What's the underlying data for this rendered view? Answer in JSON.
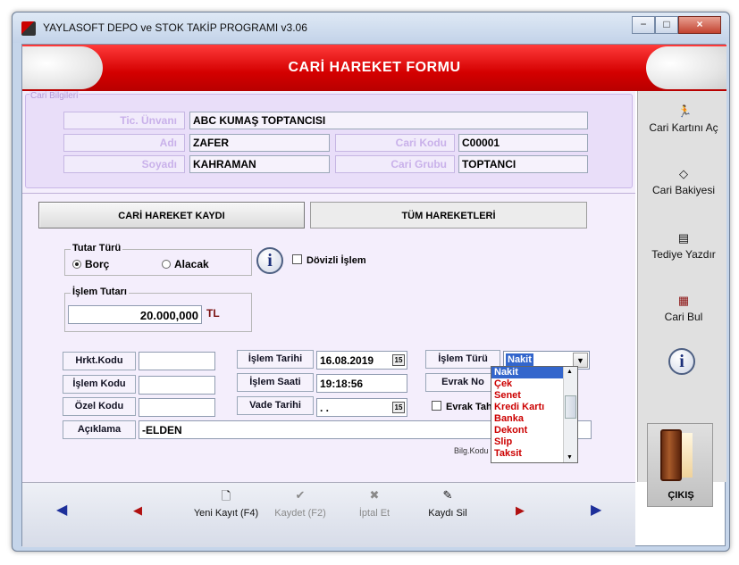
{
  "window": {
    "title": "YAYLASOFT DEPO ve STOK TAKİP PROGRAMI v3.06",
    "minimize": "−",
    "maximize": "□",
    "close": "×"
  },
  "header": {
    "title": "CARİ HAREKET FORMU"
  },
  "cari": {
    "group_title": "Cari Bilgileri",
    "unvan_label": "Tic. Ünvanı",
    "unvan": "ABC KUMAŞ TOPTANCISI",
    "adi_label": "Adı",
    "adi": "ZAFER",
    "soyadi_label": "Soyadı",
    "soyadi": "KAHRAMAN",
    "kod_label": "Cari Kodu",
    "kod": "C00001",
    "grup_label": "Cari Grubu",
    "grup": "TOPTANCI"
  },
  "tabs": [
    "CARİ HAREKET KAYDI",
    "TÜM HAREKETLERİ"
  ],
  "tutar": {
    "title": "Tutar Türü",
    "borc": "Borç",
    "alacak": "Alacak",
    "selected": "Borç",
    "doviz_label": "Dövizli İşlem"
  },
  "islem_tutari": {
    "title": "İşlem Tutarı",
    "value": "20.000,000",
    "currency": "TL"
  },
  "fields": {
    "hrkt_kodu": "Hrkt.Kodu",
    "islem_kodu": "İşlem Kodu",
    "ozel_kodu": "Özel Kodu",
    "aciklama_label": "Açıklama",
    "aciklama": "-ELDEN",
    "islem_tarihi_label": "İşlem Tarihi",
    "islem_tarihi": "16.08.2019",
    "islem_saati_label": "İşlem Saati",
    "islem_saati": "19:18:56",
    "vade_tarihi_label": "Vade Tarihi",
    "vade_tarihi": " . .",
    "islem_turu_label": "İşlem Türü",
    "islem_turu": "Nakit",
    "evrak_no_label": "Evrak No",
    "evrak_tah_label": "Evrak Tah",
    "bilg_kodu_label": "Bilg.Kodu",
    "bilg_kodu_colon": ":",
    "cal_label": "15"
  },
  "dropdown": {
    "options": [
      "Nakit",
      "Çek",
      "Senet",
      "Kredi Kartı",
      "Banka",
      "Dekont",
      "Slip",
      "Taksit"
    ],
    "selected": "Nakit"
  },
  "right_panel": {
    "cari_karti": "Cari Kartını Aç",
    "cari_bakiyesi": "Cari Bakiyesi",
    "tediye": "Tediye Yazdır",
    "cari_bul": "Cari Bul",
    "exit": "ÇIKIŞ"
  },
  "toolbar": {
    "yeni": "Yeni Kayıt (F4)",
    "kaydet": "Kaydet (F2)",
    "iptal": "İptal Et",
    "kaydi_sil": "Kaydı Sil"
  },
  "colors": {
    "header_red": "#d40000",
    "field_label": "#c9b1ea",
    "dropdown_text": "#cc0000",
    "selection": "#3366cc"
  }
}
